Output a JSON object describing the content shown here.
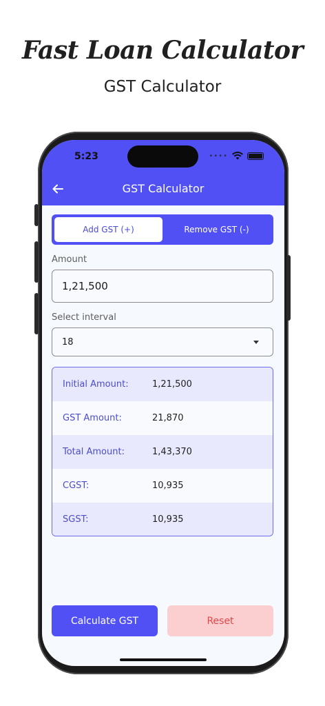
{
  "promo": {
    "title": "Fast Loan Calculator",
    "subtitle": "GST Calculator"
  },
  "status_bar": {
    "time": "5:23"
  },
  "appbar": {
    "title": "GST Calculator",
    "back_icon": "arrow-left-icon"
  },
  "segment": {
    "options": [
      {
        "label": "Add GST (+)",
        "selected": true
      },
      {
        "label": "Remove GST (-)",
        "selected": false
      }
    ]
  },
  "amount": {
    "label": "Amount",
    "value": "1,21,500"
  },
  "interval": {
    "label": "Select interval",
    "value": "18"
  },
  "results": [
    {
      "label": "Initial Amount:",
      "value": "1,21,500"
    },
    {
      "label": "GST Amount:",
      "value": "21,870"
    },
    {
      "label": "Total Amount:",
      "value": "1,43,370"
    },
    {
      "label": "CGST:",
      "value": "10,935"
    },
    {
      "label": "SGST:",
      "value": "10,935"
    }
  ],
  "buttons": {
    "calculate": "Calculate GST",
    "reset": "Reset"
  },
  "colors": {
    "primary": "#5050f5",
    "reset_bg": "#fbcfd0",
    "reset_text": "#e2474a",
    "row_shade": "#e9e9fd"
  }
}
